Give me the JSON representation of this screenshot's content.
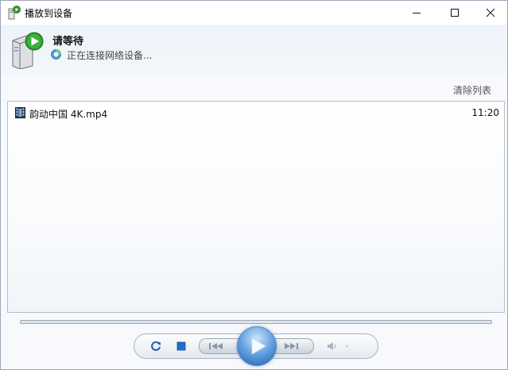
{
  "window": {
    "title": "播放到设备",
    "minimize_label": "最小化",
    "maximize_label": "最大化",
    "close_label": "关闭"
  },
  "status": {
    "title": "请等待",
    "message": "正在连接网络设备..."
  },
  "playlist": {
    "clear_label": "清除列表",
    "items": [
      {
        "name": "韵动中国 4K.mp4",
        "duration": "11:20"
      }
    ]
  },
  "controls": {
    "repeat": "repeat-icon",
    "stop": "stop-icon",
    "previous": "previous-icon",
    "play": "play-icon",
    "next": "next-icon",
    "volume": "volume-icon"
  },
  "colors": {
    "accent": "#1f5fb0",
    "header_bg": "#eef3fa",
    "status_green": "#2e9a2e"
  }
}
